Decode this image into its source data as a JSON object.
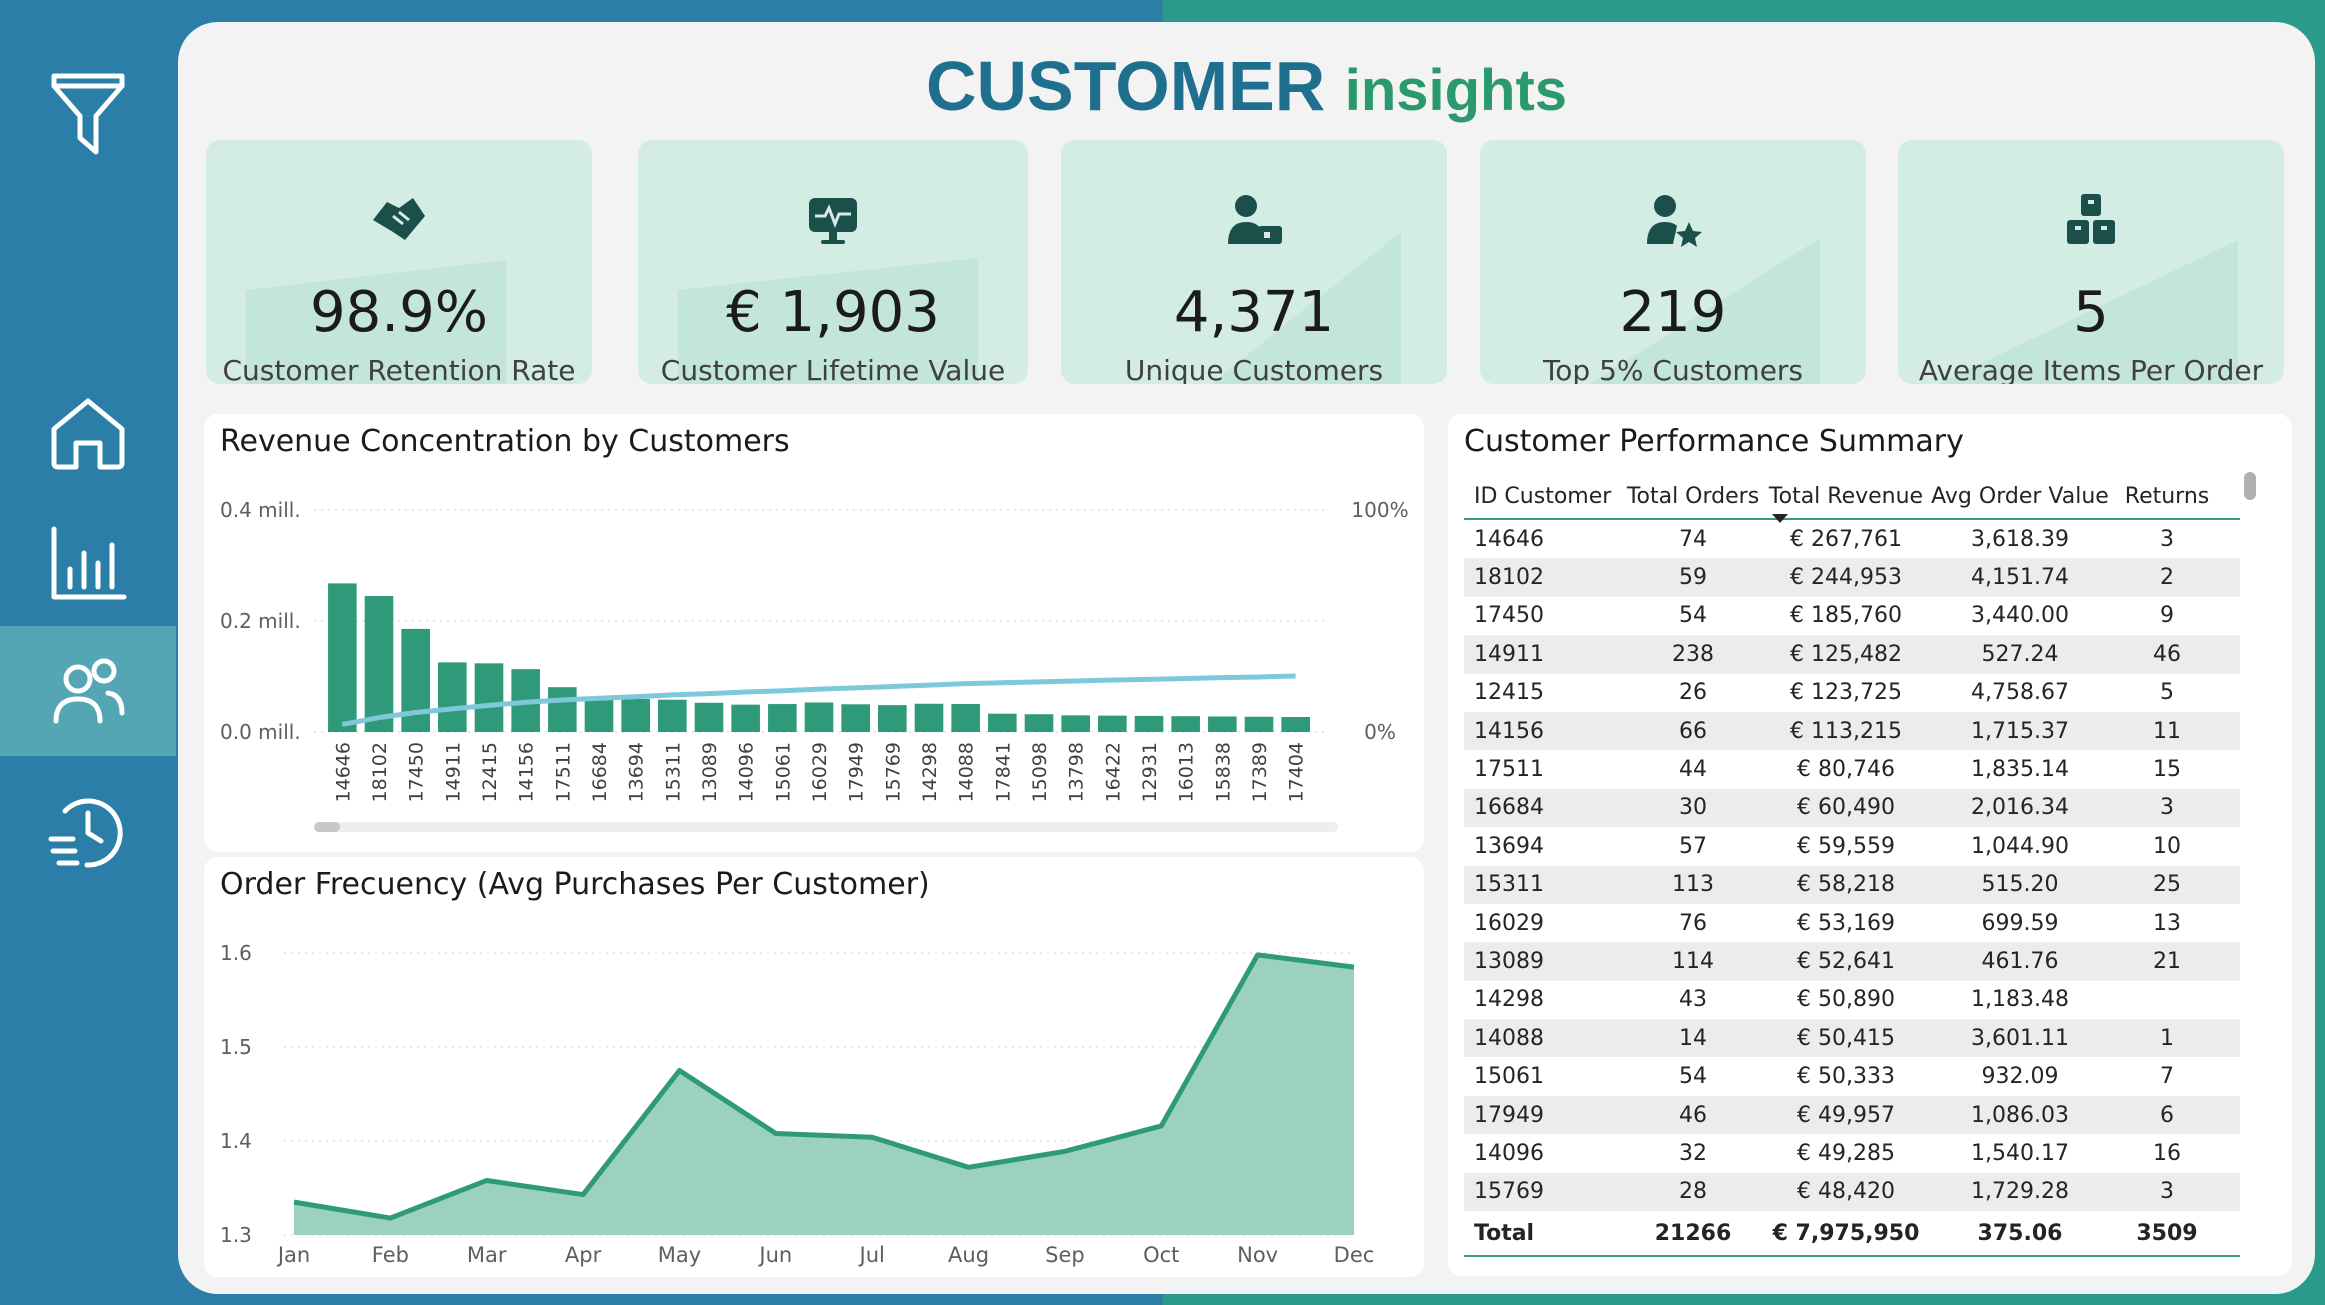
{
  "title": {
    "part1": "CUSTOMER",
    "part2": "insights"
  },
  "colors": {
    "bar": "#2f9a7a",
    "line": "#7ec8dc",
    "area_fill": "#9bd1be",
    "area_line": "#2f9a7a",
    "kpi_bg": "#d3ede4",
    "sidebar": "#2a7ea8",
    "icon": "#1b4f4a"
  },
  "sidebar": {
    "items": [
      {
        "name": "filter",
        "icon": "filter-icon"
      },
      {
        "name": "home",
        "icon": "home-icon"
      },
      {
        "name": "reports",
        "icon": "bar-chart-icon"
      },
      {
        "name": "customers",
        "icon": "users-icon",
        "active": true
      },
      {
        "name": "history",
        "icon": "history-icon"
      }
    ]
  },
  "kpis": [
    {
      "value": "98.9%",
      "label": "Customer Retention Rate",
      "icon": "handshake-icon"
    },
    {
      "value": "€ 1,903",
      "label": "Customer Lifetime Value",
      "icon": "monitor-pulse-icon"
    },
    {
      "value": "4,371",
      "label": "Unique Customers",
      "icon": "user-id-icon"
    },
    {
      "value": "219",
      "label": "Top 5% Customers",
      "icon": "user-star-icon"
    },
    {
      "value": "5",
      "label": "Average Items Per Order",
      "icon": "boxes-icon"
    }
  ],
  "revenue_chart": {
    "title": "Revenue Concentration by Customers"
  },
  "frequency_chart": {
    "title": "Order Frecuency (Avg Purchases Per Customer)"
  },
  "chart_data": [
    {
      "type": "bar",
      "title": "Revenue Concentration by Customers",
      "categories": [
        "14646",
        "18102",
        "17450",
        "14911",
        "12415",
        "14156",
        "17511",
        "16684",
        "13694",
        "15311",
        "13089",
        "14096",
        "15061",
        "16029",
        "17949",
        "15769",
        "14298",
        "14088",
        "17841",
        "15098",
        "13798",
        "16422",
        "12931",
        "16013",
        "15838",
        "17389",
        "17404"
      ],
      "series": [
        {
          "axis": "left",
          "values": [
            267761,
            244953,
            185760,
            125482,
            123725,
            113215,
            80746,
            60490,
            59559,
            58218,
            52641,
            49285,
            50333,
            53169,
            49957,
            48420,
            50890,
            50415,
            33000,
            32000,
            30000,
            29500,
            29000,
            28500,
            28000,
            27500,
            27000
          ]
        },
        {
          "axis": "right",
          "type": "line",
          "values": [
            3.4,
            6.5,
            8.8,
            10.4,
            12.0,
            13.4,
            14.4,
            15.2,
            15.9,
            16.7,
            17.3,
            18.0,
            18.6,
            19.3,
            19.9,
            20.5,
            21.1,
            21.8,
            22.2,
            22.6,
            23.0,
            23.4,
            23.7,
            24.1,
            24.5,
            24.8,
            25.2
          ]
        }
      ],
      "y_left": {
        "ticks": [
          "0.0 mill.",
          "0.2 mill.",
          "0.4 mill."
        ],
        "ylim": [
          0,
          400000
        ]
      },
      "y_right": {
        "ticks": [
          "0%",
          "100%"
        ],
        "ylim": [
          0,
          100
        ]
      },
      "grid": true
    },
    {
      "type": "area",
      "title": "Order Frecuency (Avg Purchases Per Customer)",
      "categories": [
        "Jan",
        "Feb",
        "Mar",
        "Apr",
        "May",
        "Jun",
        "Jul",
        "Aug",
        "Sep",
        "Oct",
        "Nov",
        "Dec"
      ],
      "values": [
        1.335,
        1.318,
        1.358,
        1.343,
        1.475,
        1.408,
        1.404,
        1.372,
        1.389,
        1.416,
        1.598,
        1.585
      ],
      "y_ticks": [
        "1.3",
        "1.4",
        "1.5",
        "1.6"
      ],
      "ylim": [
        1.3,
        1.6
      ],
      "grid": true
    }
  ],
  "table": {
    "title": "Customer Performance Summary",
    "headers": [
      "ID Customer",
      "Total Orders",
      "Total Revenue",
      "Avg Order Value",
      "Returns"
    ],
    "rows": [
      [
        "14646",
        "74",
        "€ 267,761",
        "3,618.39",
        "3"
      ],
      [
        "18102",
        "59",
        "€ 244,953",
        "4,151.74",
        "2"
      ],
      [
        "17450",
        "54",
        "€ 185,760",
        "3,440.00",
        "9"
      ],
      [
        "14911",
        "238",
        "€ 125,482",
        "527.24",
        "46"
      ],
      [
        "12415",
        "26",
        "€ 123,725",
        "4,758.67",
        "5"
      ],
      [
        "14156",
        "66",
        "€ 113,215",
        "1,715.37",
        "11"
      ],
      [
        "17511",
        "44",
        "€ 80,746",
        "1,835.14",
        "15"
      ],
      [
        "16684",
        "30",
        "€ 60,490",
        "2,016.34",
        "3"
      ],
      [
        "13694",
        "57",
        "€ 59,559",
        "1,044.90",
        "10"
      ],
      [
        "15311",
        "113",
        "€ 58,218",
        "515.20",
        "25"
      ],
      [
        "16029",
        "76",
        "€ 53,169",
        "699.59",
        "13"
      ],
      [
        "13089",
        "114",
        "€ 52,641",
        "461.76",
        "21"
      ],
      [
        "14298",
        "43",
        "€ 50,890",
        "1,183.48",
        ""
      ],
      [
        "14088",
        "14",
        "€ 50,415",
        "3,601.11",
        "1"
      ],
      [
        "15061",
        "54",
        "€ 50,333",
        "932.09",
        "7"
      ],
      [
        "17949",
        "46",
        "€ 49,957",
        "1,086.03",
        "6"
      ],
      [
        "14096",
        "32",
        "€ 49,285",
        "1,540.17",
        "16"
      ],
      [
        "15769",
        "28",
        "€ 48,420",
        "1,729.28",
        "3"
      ]
    ],
    "total": [
      "Total",
      "21266",
      "€ 7,975,950",
      "375.06",
      "3509"
    ]
  }
}
